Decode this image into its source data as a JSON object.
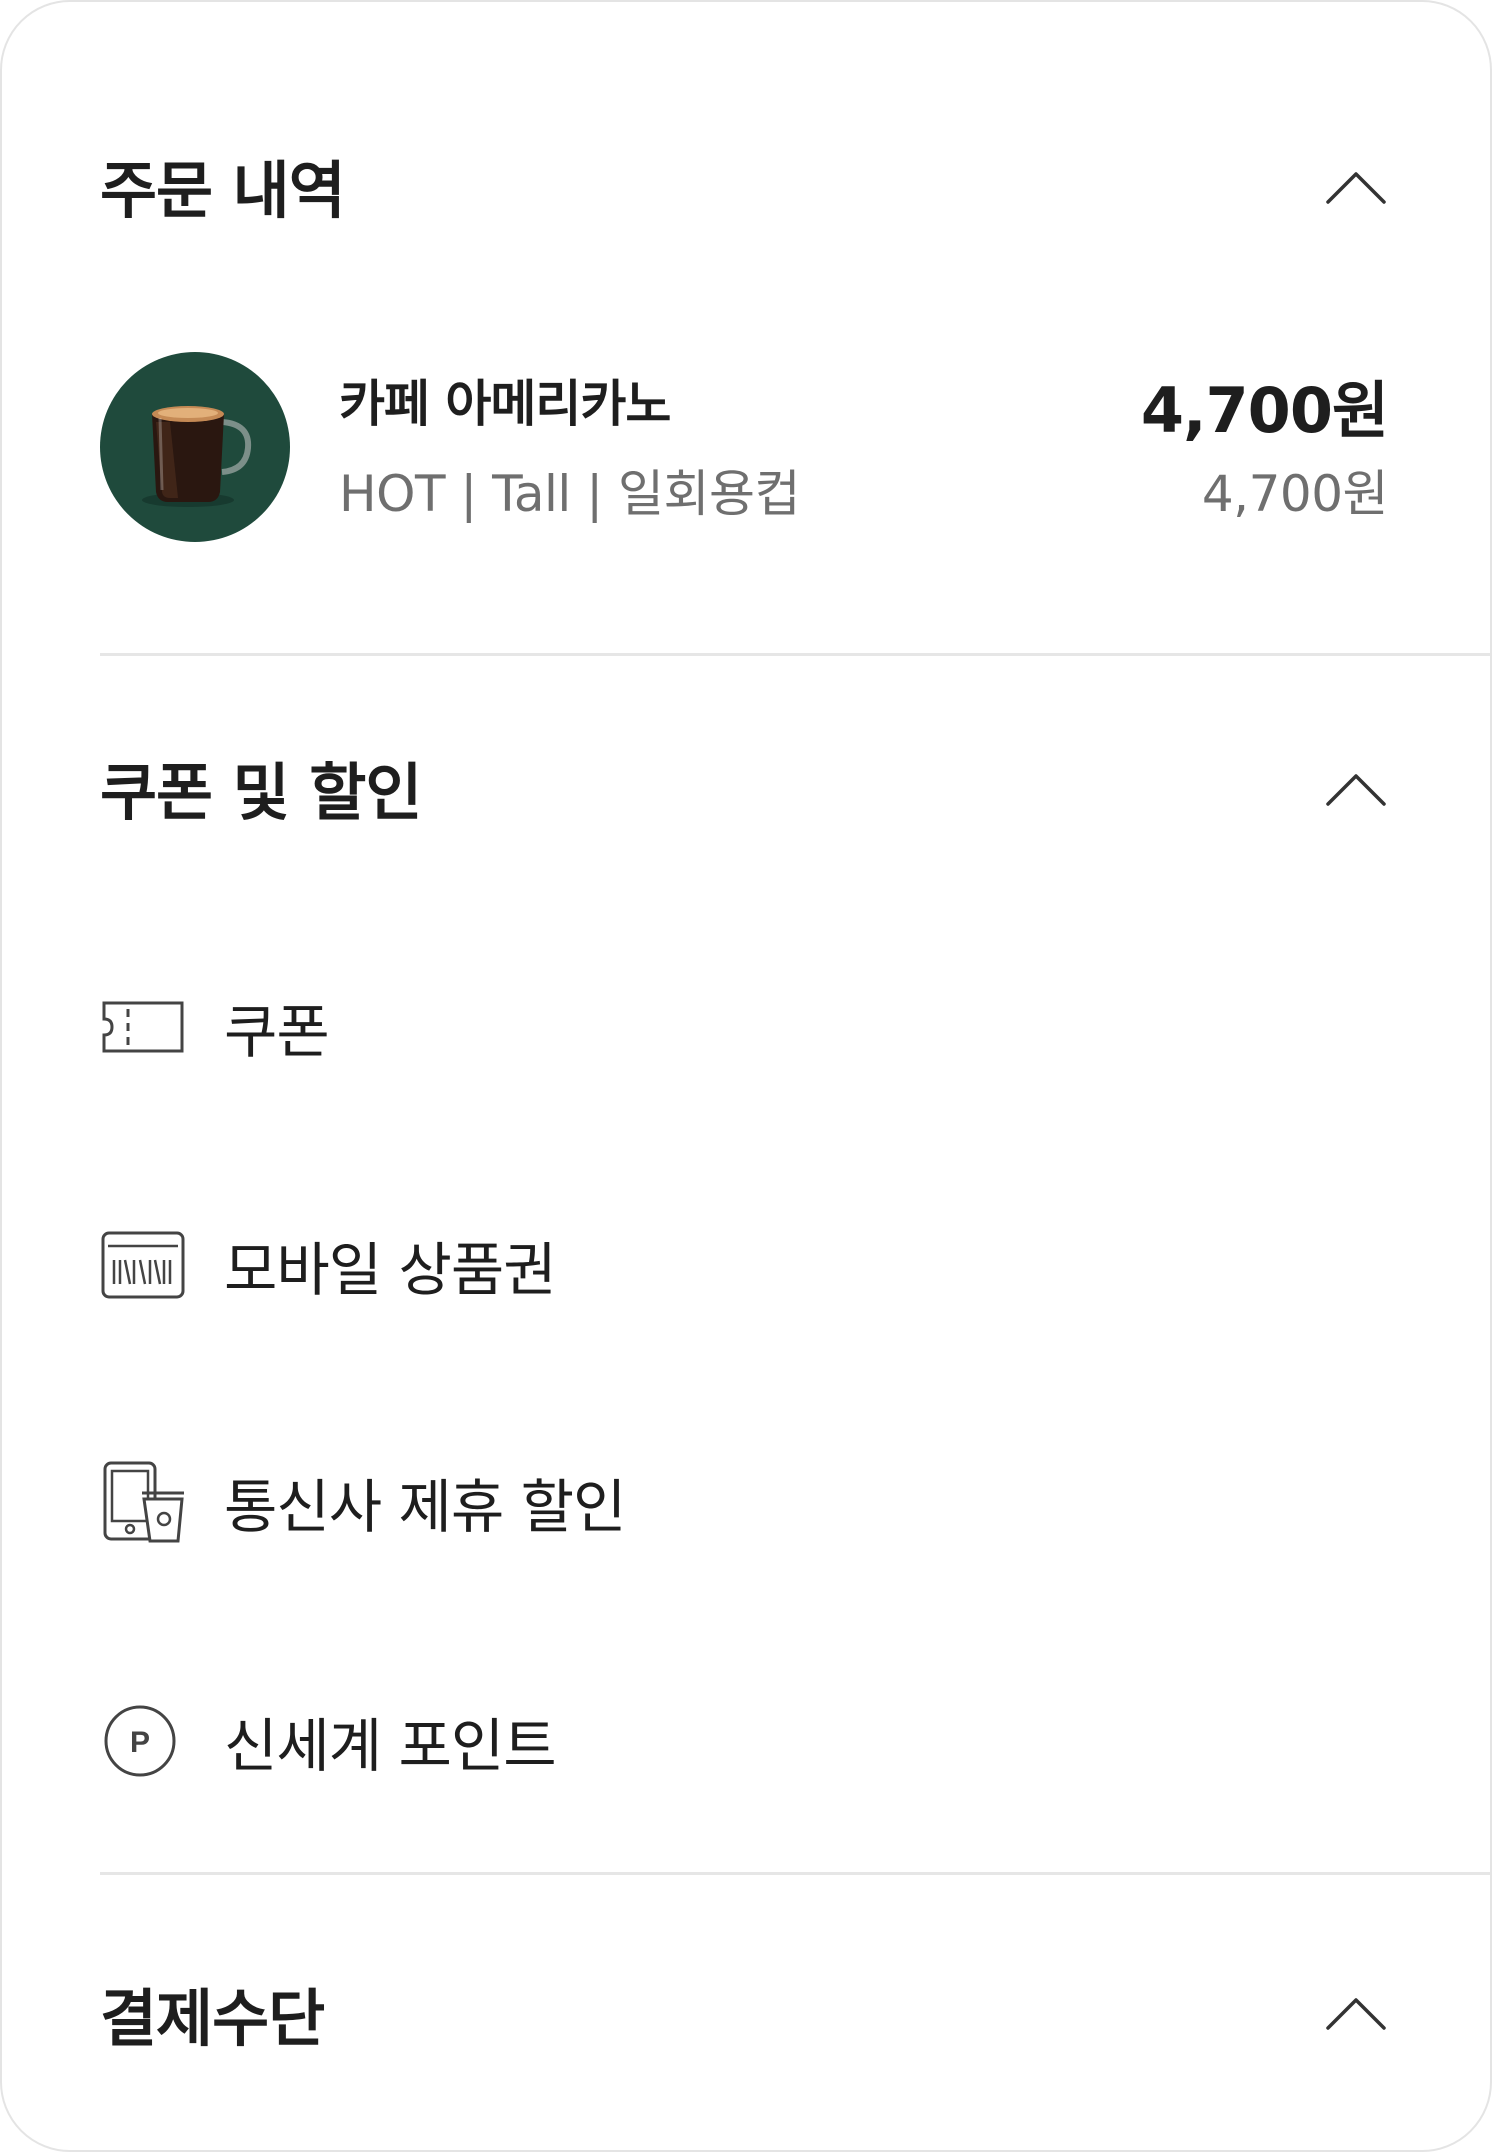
{
  "order": {
    "title": "주문 내역",
    "item": {
      "name": "카페 아메리카노",
      "options": "HOT | Tall | 일회용컵",
      "price": "4,700원",
      "unit_price": "4,700원"
    }
  },
  "discount": {
    "title": "쿠폰 및 할인",
    "items": [
      {
        "label": "쿠폰",
        "icon": "coupon-ticket-icon"
      },
      {
        "label": "모바일 상품권",
        "icon": "barcode-voucher-icon"
      },
      {
        "label": "통신사 제휴 할인",
        "icon": "phone-cup-icon"
      },
      {
        "label": "신세계 포인트",
        "icon": "point-p-icon"
      }
    ]
  },
  "payment": {
    "title": "결제수단"
  },
  "colors": {
    "text": "#1e1e1e",
    "muted": "#6f6f6f",
    "thumb_bg": "#1f4a3c",
    "divider": "#e6e6e6"
  }
}
